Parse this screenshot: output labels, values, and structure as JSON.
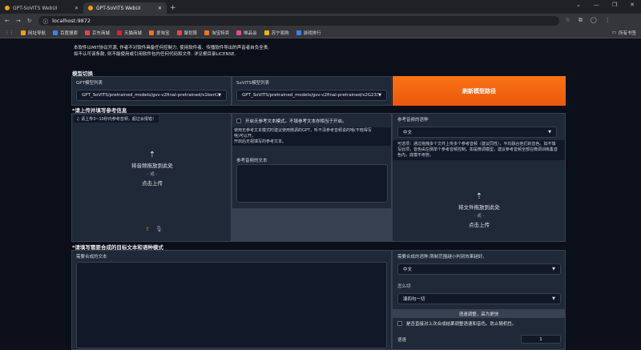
{
  "tabs": [
    {
      "title": "GPT-SoVITS WebUI"
    },
    {
      "title": "GPT-SoVITS WebUI"
    }
  ],
  "address": "localhost:9872",
  "bookmarks": [
    "网址导航",
    "百度搜索",
    "京东商城",
    "天猫商城",
    "爱淘宝",
    "聚划算",
    "淘宝特卖",
    "唯品会",
    "苏宁易购",
    "游戏排行"
  ],
  "bookmarks_right": "所有书签",
  "intro": [
    "本软件以MIT协议开源, 作者不对软件具备任何控制力, 使用软件者、传播软件导出的声音者自负全责.",
    "如不认可该条款, 则不能使用或引用软件包内任何代码和文件. 详见根目录LICENSE."
  ],
  "model": {
    "section": "模型切换",
    "gpt_label": "GPT模型列表",
    "gpt_value": "GPT_SoVITS/pretrained_models/gsv-v2final-pretrained/s1bert25hz-",
    "sovits_label": "SoVITS模型列表",
    "sovits_value": "GPT_SoVITS/pretrained_models/gsv-v2final-pretrained/s2G2333k.p",
    "refresh": "刷新模型路径"
  },
  "ref": {
    "section": "*请上传并填写参考信息",
    "upload_hint": "请上传3~10秒内参考音频，超过会报错！",
    "drop": "将音频拖放到此处",
    "or": "- 或 -",
    "click": "点击上传",
    "no_ref_check": "开启无参考文本模式。不填参考文本亦相当于开启。",
    "no_ref_note": [
      "使用无参考文本模式时建议使用微调的GPT，听不清参考音频说的啥(不晓得写",
      "啥)可以开。",
      "开启后无视填写的参考文本。"
    ],
    "ref_text_label": "参考音频的文本",
    "lang_label": "参考音频的语种",
    "lang_value": "中文",
    "multi_note": [
      "可选项：通过拖拽多个文件上传多个参考音频（建议同性），平均融合他们的音色。如不填",
      "写此项，音色由左侧单个参考音频控制。如是微调模型，建议参考音频全部在微调训练集音",
      "色内，底模不用管。"
    ],
    "drop2": "将文件拖放到此处",
    "or2": "- 或 -",
    "click2": "点击上传"
  },
  "synth": {
    "section": "*请填写需要合成的目标文本和语种模式",
    "text_label": "需要合成的文本",
    "lang_label": "需要合成的语种.限制范围越小判别效果越好。",
    "lang_value": "中文",
    "cut_label": "怎么切",
    "cut_value": "凑四句一切",
    "speed_bar": "语速调整，高为更快",
    "seed_check": "是否直接对上次合成结果调整语速和音色。防止随机性。",
    "speed_label": "语速",
    "speed_value": "1"
  }
}
